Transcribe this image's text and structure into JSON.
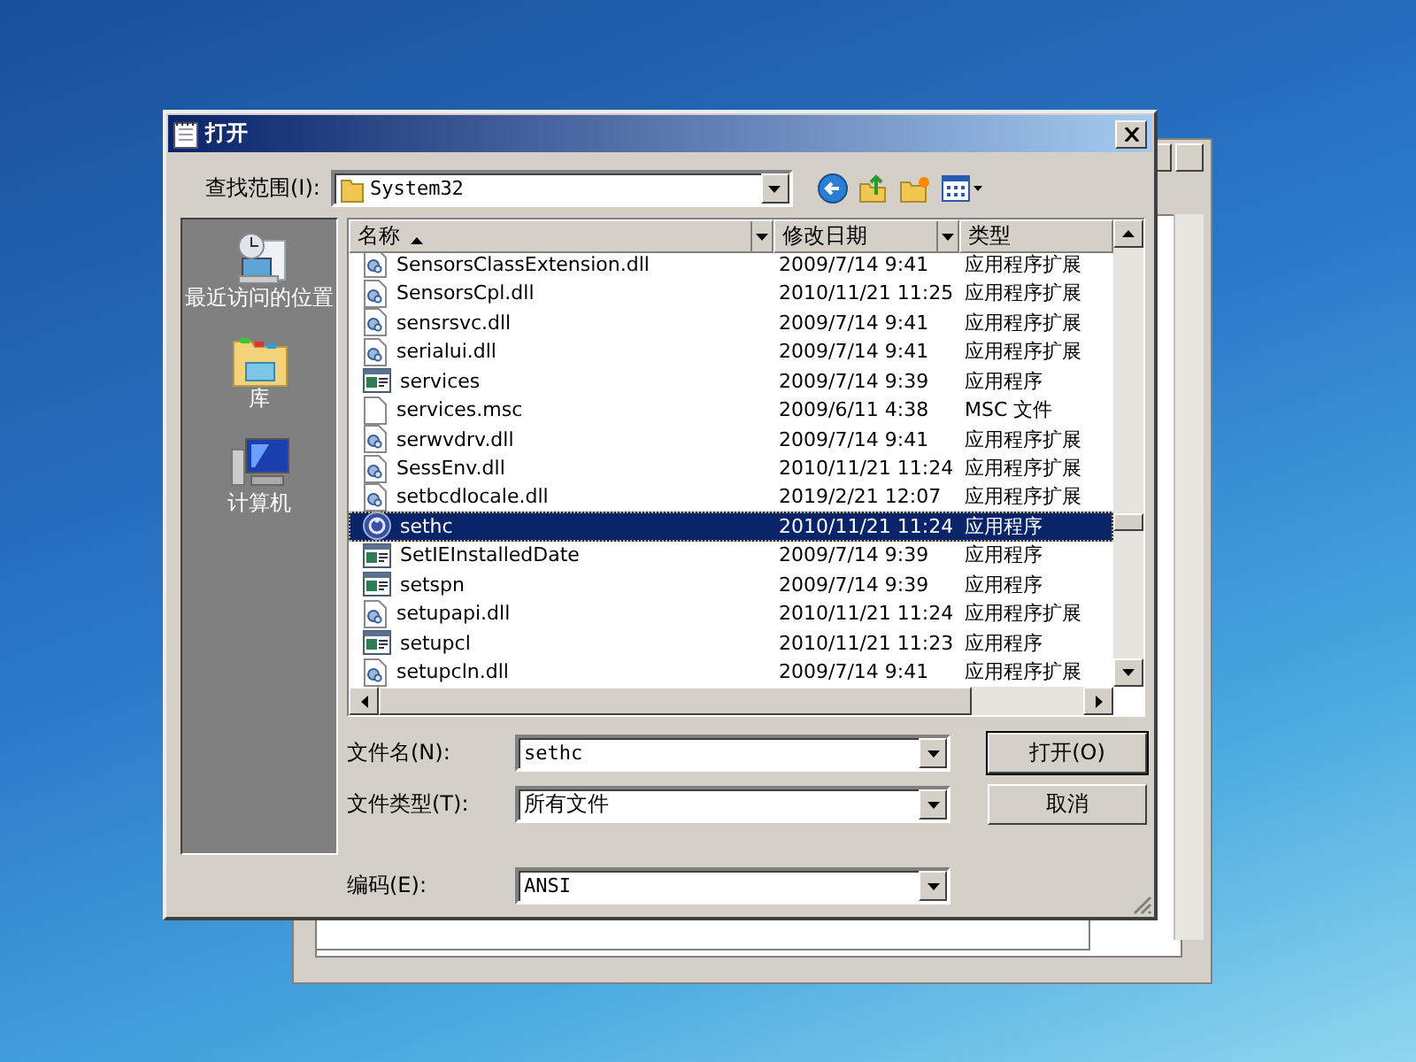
{
  "dialog": {
    "title": "打开",
    "look_in": {
      "label": "查找范围(I):",
      "value": "System32"
    },
    "places": [
      {
        "label": "最近访问的位置",
        "kind": "recent"
      },
      {
        "label": "库",
        "kind": "library"
      },
      {
        "label": "计算机",
        "kind": "computer"
      }
    ],
    "columns": [
      {
        "label": "名称",
        "sorted": true
      },
      {
        "label": "修改日期",
        "sorted": false
      },
      {
        "label": "类型",
        "sorted": false
      }
    ],
    "rows": [
      {
        "name": "SensorsClassExtension.dll",
        "date": "2009/7/14 9:41",
        "type": "应用程序扩展",
        "kind": "dll",
        "selected": false
      },
      {
        "name": "SensorsCpl.dll",
        "date": "2010/11/21 11:25",
        "type": "应用程序扩展",
        "kind": "dll",
        "selected": false
      },
      {
        "name": "sensrsvc.dll",
        "date": "2009/7/14 9:41",
        "type": "应用程序扩展",
        "kind": "dll",
        "selected": false
      },
      {
        "name": "serialui.dll",
        "date": "2009/7/14 9:41",
        "type": "应用程序扩展",
        "kind": "dll",
        "selected": false
      },
      {
        "name": "services",
        "date": "2009/7/14 9:39",
        "type": "应用程序",
        "kind": "exe",
        "selected": false
      },
      {
        "name": "services.msc",
        "date": "2009/6/11 4:38",
        "type": "MSC 文件",
        "kind": "file",
        "selected": false
      },
      {
        "name": "serwvdrv.dll",
        "date": "2009/7/14 9:41",
        "type": "应用程序扩展",
        "kind": "dll",
        "selected": false
      },
      {
        "name": "SessEnv.dll",
        "date": "2010/11/21 11:24",
        "type": "应用程序扩展",
        "kind": "dll",
        "selected": false
      },
      {
        "name": "setbcdlocale.dll",
        "date": "2019/2/21 12:07",
        "type": "应用程序扩展",
        "kind": "dll",
        "selected": false
      },
      {
        "name": "sethc",
        "date": "2010/11/21 11:24",
        "type": "应用程序",
        "kind": "round",
        "selected": true
      },
      {
        "name": "SetIEInstalledDate",
        "date": "2009/7/14 9:39",
        "type": "应用程序",
        "kind": "exe",
        "selected": false
      },
      {
        "name": "setspn",
        "date": "2009/7/14 9:39",
        "type": "应用程序",
        "kind": "exe",
        "selected": false
      },
      {
        "name": "setupapi.dll",
        "date": "2010/11/21 11:24",
        "type": "应用程序扩展",
        "kind": "dll",
        "selected": false
      },
      {
        "name": "setupcl",
        "date": "2010/11/21 11:23",
        "type": "应用程序",
        "kind": "exe",
        "selected": false
      },
      {
        "name": "setupcln.dll",
        "date": "2009/7/14 9:41",
        "type": "应用程序扩展",
        "kind": "dll",
        "selected": false
      }
    ],
    "fields": [
      {
        "label": "文件名(N):",
        "value": "sethc",
        "mono": true
      },
      {
        "label": "文件类型(T):",
        "value": "所有文件",
        "mono": false
      },
      {
        "label": "编码(E):",
        "value": "ANSI",
        "mono": true
      }
    ],
    "buttons": [
      {
        "label": "打开(O)",
        "default": true
      },
      {
        "label": "取消",
        "default": false
      }
    ]
  }
}
